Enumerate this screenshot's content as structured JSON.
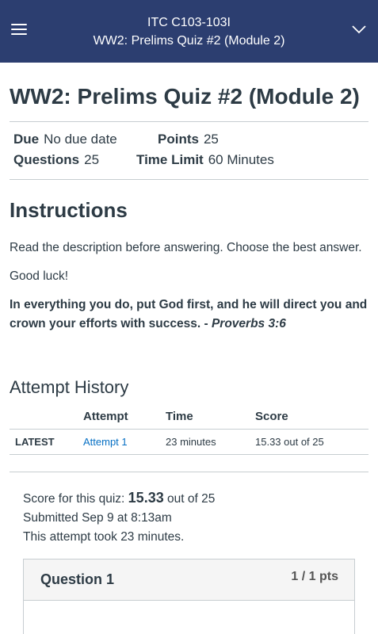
{
  "header": {
    "course": "ITC C103-103I",
    "title": "WW2: Prelims Quiz #2 (Module 2)",
    "background_color": "#2c3e70"
  },
  "quiz": {
    "title": "WW2: Prelims Quiz #2 (Module 2)",
    "due_label": "Due",
    "due_value": "No due date",
    "points_label": "Points",
    "points_value": "25",
    "questions_label": "Questions",
    "questions_value": "25",
    "time_limit_label": "Time Limit",
    "time_limit_value": "60 Minutes"
  },
  "instructions": {
    "heading": "Instructions",
    "para1": "Read the description before answering. Choose the best answer.",
    "para2": "Good luck!",
    "para3_bold": "In everything you do, put God first, and he will direct you and crown your efforts with success. - ",
    "para3_italic": "Proverbs 3:6"
  },
  "attempt_history": {
    "heading": "Attempt History",
    "columns": [
      "",
      "Attempt",
      "Time",
      "Score"
    ],
    "rows": [
      {
        "tag": "LATEST",
        "attempt": "Attempt 1",
        "time": "23 minutes",
        "score": "15.33 out of 25"
      }
    ]
  },
  "score_summary": {
    "prefix": "Score for this quiz: ",
    "score": "15.33",
    "suffix": " out of 25",
    "submitted": "Submitted Sep 9 at 8:13am",
    "duration": "This attempt took 23 minutes."
  },
  "question": {
    "title": "Question 1",
    "points": "1 / 1 pts"
  },
  "link_color": "#0770c4"
}
